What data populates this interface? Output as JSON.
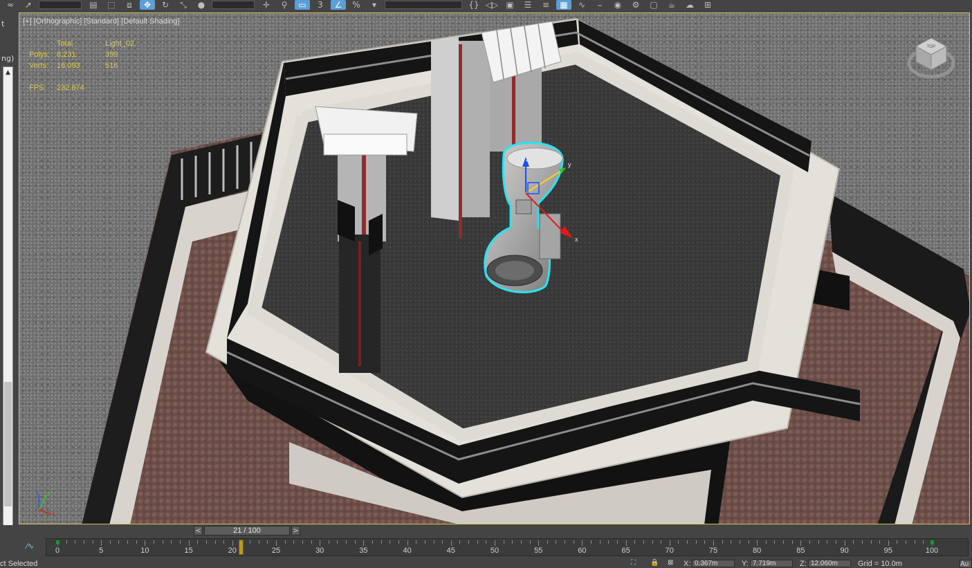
{
  "toolbar": {
    "buttons": [
      {
        "name": "bind-spacewarp-icon",
        "glyph": "≈"
      },
      {
        "name": "select-object-icon",
        "glyph": "➚"
      },
      {
        "name": "select-by-name-icon",
        "glyph": "▤"
      },
      {
        "name": "rectangular-selection-icon",
        "glyph": "⬚"
      },
      {
        "name": "window-crossing-icon",
        "glyph": "⧈"
      },
      {
        "name": "select-and-move-icon",
        "glyph": "✥"
      },
      {
        "name": "select-and-rotate-icon",
        "glyph": "↻"
      },
      {
        "name": "select-and-scale-icon",
        "glyph": "⤡"
      },
      {
        "name": "select-and-place-icon",
        "glyph": "●"
      },
      {
        "name": "use-pivot-center-icon",
        "glyph": "✛"
      },
      {
        "name": "select-manipulate-icon",
        "glyph": "⚲"
      },
      {
        "name": "keyboard-shortcut-override-icon",
        "glyph": "▭"
      },
      {
        "name": "snaps-toggle-icon",
        "glyph": "3"
      },
      {
        "name": "angle-snap-icon",
        "glyph": "∠"
      },
      {
        "name": "percent-snap-icon",
        "glyph": "%"
      },
      {
        "name": "spinner-snap-icon",
        "glyph": "▾"
      },
      {
        "name": "named-selection-icon",
        "glyph": "{}"
      },
      {
        "name": "mirror-icon",
        "glyph": "◁▷"
      },
      {
        "name": "align-icon",
        "glyph": "▣"
      },
      {
        "name": "scene-explorer-icon",
        "glyph": "☰"
      },
      {
        "name": "layer-explorer-icon",
        "glyph": "≡"
      },
      {
        "name": "toggle-ribbon-icon",
        "glyph": "▦"
      },
      {
        "name": "curve-editor-icon",
        "glyph": "∿"
      },
      {
        "name": "schematic-view-icon",
        "glyph": "⎯"
      },
      {
        "name": "material-editor-icon",
        "glyph": "◉"
      },
      {
        "name": "render-setup-icon",
        "glyph": "⚙"
      },
      {
        "name": "rendered-frame-window-icon",
        "glyph": "▢"
      },
      {
        "name": "render-production-icon",
        "glyph": "☕"
      },
      {
        "name": "render-in-cloud-icon",
        "glyph": "☁"
      },
      {
        "name": "a360-gallery-icon",
        "glyph": "⊞"
      }
    ]
  },
  "left_panel": {
    "text_top": "t",
    "text_mid": "ng)"
  },
  "viewport": {
    "label": "[+] [Orthographic] [Standard] [Default Shading]",
    "stats": {
      "header_total": "Total",
      "header_object": "Light_02",
      "rows": [
        {
          "label": "Polys:",
          "total": "8,231",
          "object": "399"
        },
        {
          "label": "Verts:",
          "total": "16,093",
          "object": "516"
        }
      ],
      "fps_label": "FPS:",
      "fps_value": "232.874"
    },
    "gizmo_axes": {
      "x": "x",
      "y": "y",
      "z": "z"
    },
    "tripod_axes": {
      "x": "x",
      "y": "y",
      "z": "z"
    },
    "viewcube_label": "TOP"
  },
  "time_slider": {
    "prev": "<",
    "next": ">",
    "position": "21 / 100",
    "current_frame": 21,
    "total_frames": 100
  },
  "trackbar": {
    "ticks": [
      0,
      5,
      10,
      15,
      20,
      25,
      30,
      35,
      40,
      45,
      50,
      55,
      60,
      65,
      70,
      75,
      80,
      85,
      90,
      95,
      100
    ],
    "keys": [
      0,
      100
    ]
  },
  "status_bar": {
    "status_text": "ct Selected",
    "x_label": "X:",
    "x_value": "0.367m",
    "y_label": "Y:",
    "y_value": "7.719m",
    "z_label": "Z:",
    "z_value": "12.060m",
    "grid_text": "Grid = 10.0m",
    "auto_key": "Au"
  },
  "colors": {
    "viewport_border": "#d8c55a",
    "stats_text": "#e0c84a",
    "selection_outline": "#27e4f0",
    "active_tool": "#5a9fd6",
    "frame_marker": "#b59a2a"
  }
}
